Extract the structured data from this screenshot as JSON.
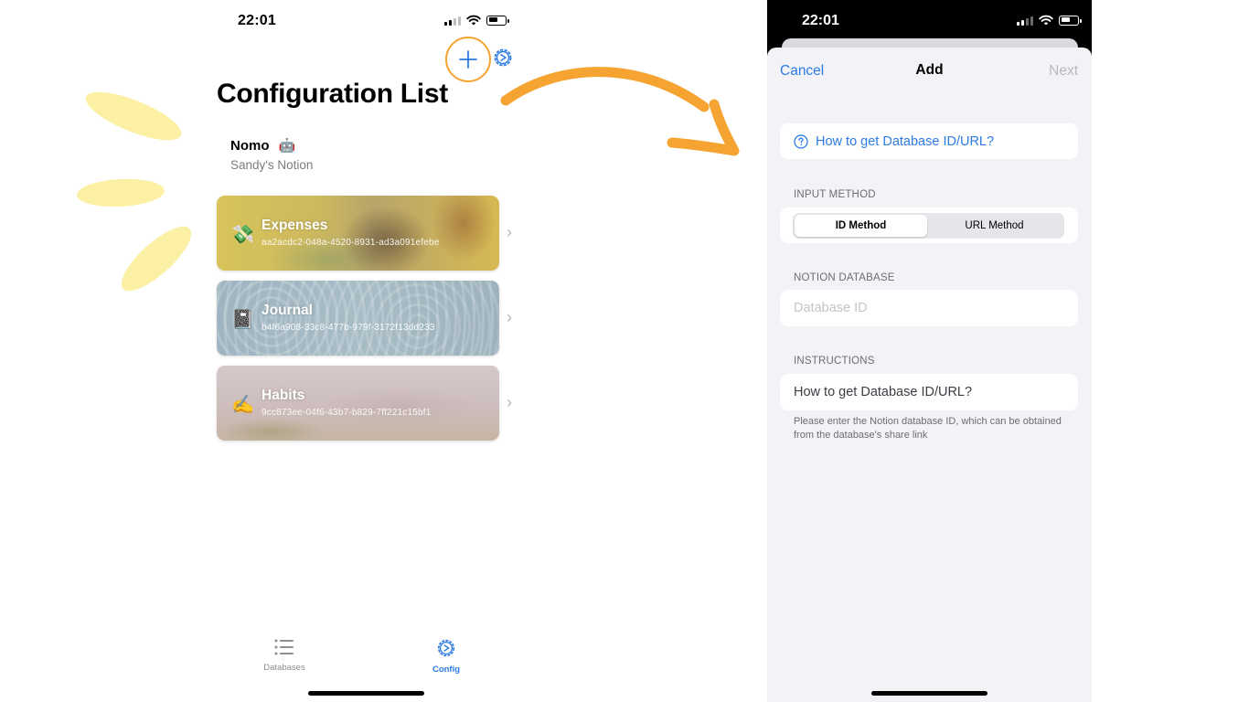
{
  "left_screen": {
    "status_time": "22:01",
    "title": "Configuration List",
    "profile": {
      "name": "Nomo",
      "emoji": "🤖",
      "subtitle": "Sandy's Notion"
    },
    "cards": [
      {
        "emoji": "💸",
        "name": "Expenses",
        "id": "aa2acdc2-048a-4520-8931-ad3a091efebe"
      },
      {
        "emoji": "📓",
        "name": "Journal",
        "id": "b4f6a908-33c8-477b-979f-3172f13dd233"
      },
      {
        "emoji": "✍️",
        "name": "Habits",
        "id": "9cc873ee-04f6-43b7-b829-7ff221c15bf1"
      }
    ],
    "tabs": [
      {
        "label": "Databases",
        "icon": "list-icon",
        "active": false
      },
      {
        "label": "Config",
        "icon": "gear-icon",
        "active": true
      }
    ],
    "highlight_color": "#f5a431",
    "accent_color": "#2c7be5"
  },
  "right_screen": {
    "status_time": "22:01",
    "nav": {
      "cancel": "Cancel",
      "title": "Add",
      "next": "Next"
    },
    "help_link": "How to get Database ID/URL?",
    "input_method": {
      "section_label": "INPUT METHOD",
      "options": [
        "ID Method",
        "URL Method"
      ],
      "selected": "ID Method"
    },
    "notion_database": {
      "section_label": "NOTION DATABASE",
      "placeholder": "Database ID",
      "value": ""
    },
    "instructions": {
      "section_label": "INSTRUCTIONS",
      "value": "How to get Database ID/URL?",
      "note": "Please enter the Notion database ID, which can be obtained from the database's share link"
    }
  }
}
